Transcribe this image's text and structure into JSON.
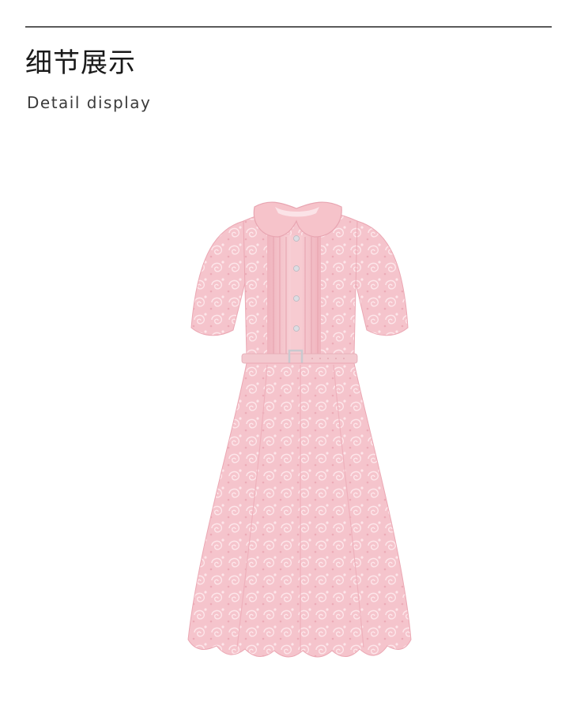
{
  "header": {
    "title_cn": "细节展示",
    "title_en": "Detail display"
  },
  "product": {
    "icon": "pink-lace-dress-image",
    "colors": {
      "lace": "#f4bfc7",
      "lace_shadow": "#e9a3b0",
      "collar": "#f6c3ca",
      "belt": "#f3c9cf",
      "buttons": "#dcdde3"
    }
  }
}
